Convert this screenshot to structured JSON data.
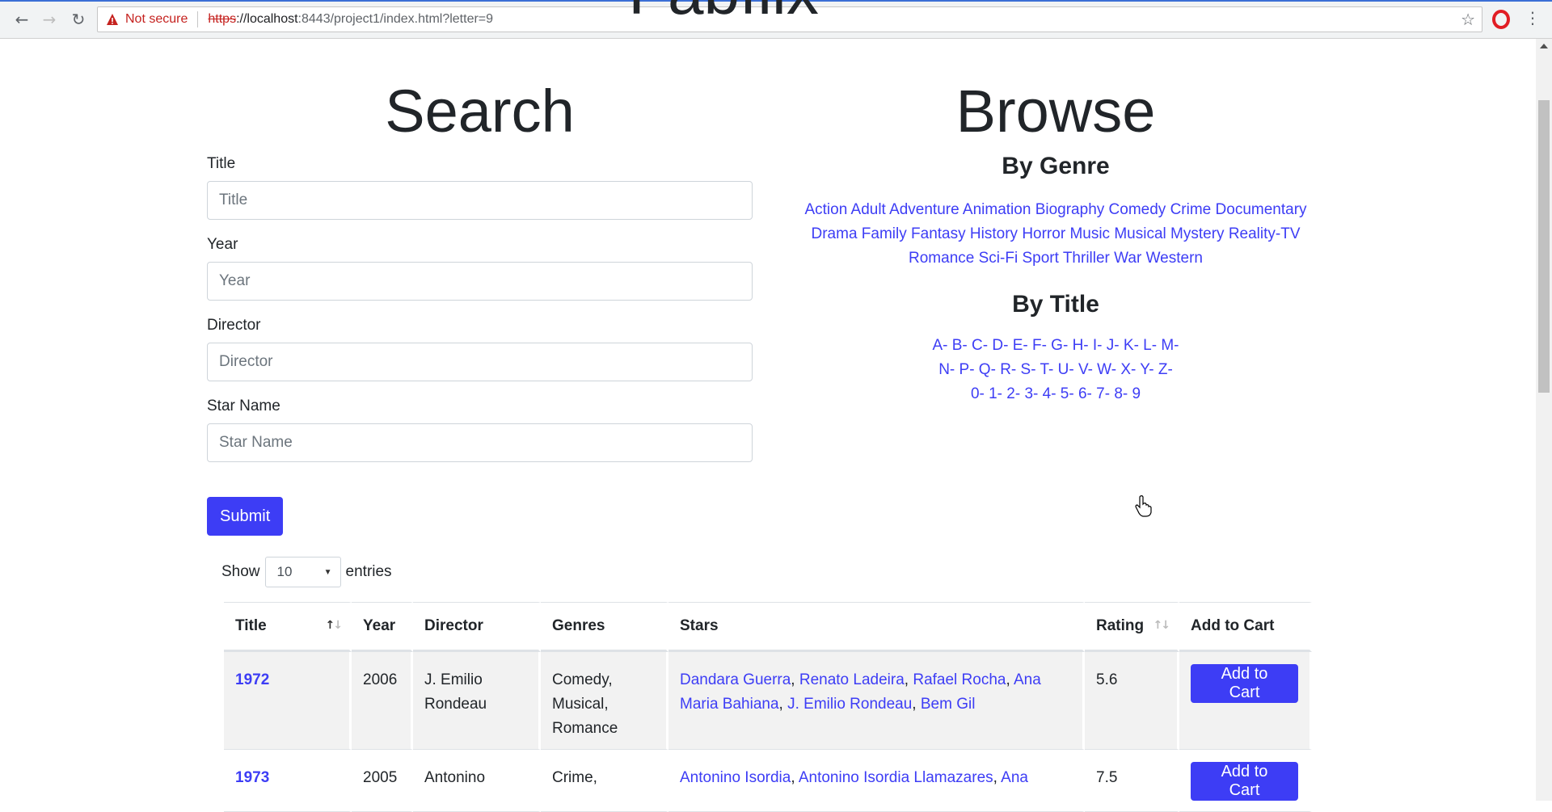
{
  "browser": {
    "not_secure": "Not secure",
    "url_scheme": "https",
    "url_host": "://localhost",
    "url_rest": ":8443/project1/index.html?letter=9"
  },
  "brand": "Fabflix",
  "search": {
    "heading": "Search",
    "fields": [
      {
        "label": "Title",
        "placeholder": "Title"
      },
      {
        "label": "Year",
        "placeholder": "Year"
      },
      {
        "label": "Director",
        "placeholder": "Director"
      },
      {
        "label": "Star Name",
        "placeholder": "Star Name"
      }
    ],
    "submit_label": "Submit"
  },
  "browse": {
    "heading": "Browse",
    "by_genre_label": "By Genre",
    "genres": [
      "Action",
      "Adult",
      "Adventure",
      "Animation",
      "Biography",
      "Comedy",
      "Crime",
      "Documentary",
      "Drama",
      "Family",
      "Fantasy",
      "History",
      "Horror",
      "Music",
      "Musical",
      "Mystery",
      "Reality-TV",
      "Romance",
      "Sci-Fi",
      "Sport",
      "Thriller",
      "War",
      "Western"
    ],
    "by_title_label": "By Title",
    "letters_row1": "A- B- C- D- E- F- G- H- I- J- K- L- M-",
    "letters_row2": "N- P- Q- R- S- T- U- V- W- X- Y- Z-",
    "letters_row3": "0- 1- 2- 3- 4- 5- 6- 7- 8- 9"
  },
  "entries": {
    "show_label": "Show",
    "selected": "10",
    "entries_label": "entries"
  },
  "table": {
    "headers": [
      "Title",
      "Year",
      "Director",
      "Genres",
      "Stars",
      "Rating",
      "Add to Cart"
    ],
    "cart_label": "Add to Cart",
    "rows": [
      {
        "title": "1972",
        "year": "2006",
        "director_l1": "J. Emilio",
        "director_l2": "Rondeau",
        "genres_l1": "Comedy,",
        "genres_l2": "Musical,",
        "genres_l3": "Romance",
        "stars": [
          "Dandara Guerra",
          "Renato Ladeira",
          "Rafael Rocha",
          "Ana Maria Bahiana",
          "J. Emilio Rondeau",
          "Bem Gil"
        ],
        "rating": "5.6"
      },
      {
        "title": "1973",
        "year": "2005",
        "director_l1": "Antonino",
        "genres_l1": "Crime,",
        "stars": [
          "Antonino Isordia",
          "Antonino Isordia Llamazares",
          "Ana"
        ],
        "rating": "7.5"
      }
    ]
  }
}
